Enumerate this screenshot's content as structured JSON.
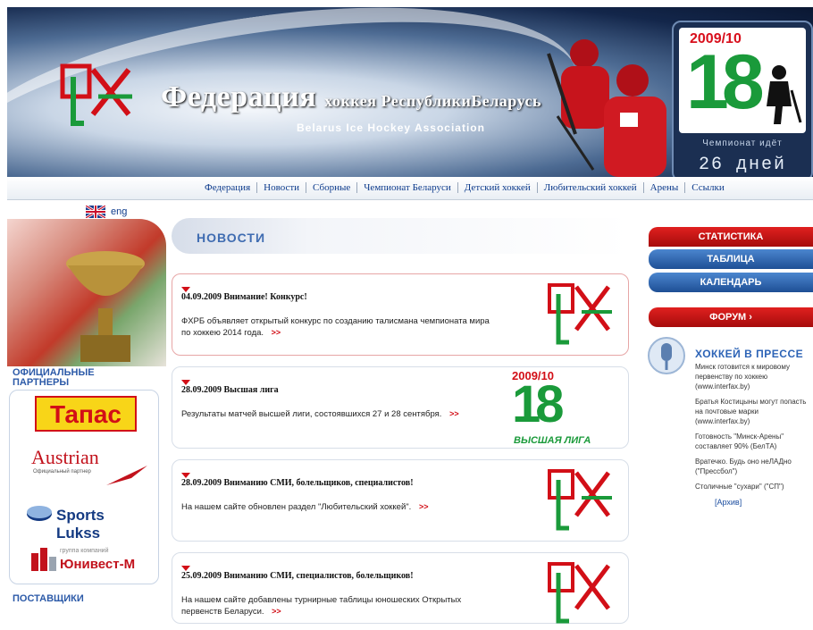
{
  "header": {
    "title_big": "Федерация",
    "title_small": "хоккея РеспубликиБеларусь",
    "subtitle": "Belarus Ice Hockey Association",
    "logo_text": "ФХ",
    "championship": {
      "season": "2009/10",
      "number": "18",
      "label": "Чемпионат идёт",
      "days": "26 дней"
    }
  },
  "nav": {
    "items": [
      "Федерация",
      "Новости",
      "Сборные",
      "Чемпионат Беларуси",
      "Детский хоккей",
      "Любительский хоккей",
      "Арены",
      "Ссылки"
    ]
  },
  "lang": {
    "label": "eng"
  },
  "partners": {
    "heading": "Официальные партнеры",
    "items": {
      "tapas": "Тапас",
      "austrian": "Austrian",
      "austrian_sub": "Официальный партнер",
      "sportslukss": "Sports Lukss",
      "univest_sub": "группа компаний",
      "univest": "Юнивест-М"
    }
  },
  "suppliers": {
    "heading": "Поставщики"
  },
  "news": {
    "title": "НОВОСТИ",
    "items": [
      {
        "headline": "04.09.2009 Внимание! Конкурс!",
        "body": "ФХРБ объявляет открытый конкурс по созданию талисмана чемпионата мира по хоккею 2014 года.",
        "more": ">>"
      },
      {
        "headline": "28.09.2009 Высшая лига",
        "body": "Результаты матчей высшей лиги, состоявшихся 27 и 28 сентября.",
        "more": ">>",
        "badge_season": "2009/10",
        "badge_number": "18",
        "badge_league": "ВЫСШАЯ ЛИГА"
      },
      {
        "headline": "28.09.2009 Вниманию СМИ, болельщиков, специалистов!",
        "body": "На нашем сайте обновлен раздел \"Любительский хоккей\".",
        "more": ">>"
      },
      {
        "headline": "25.09.2009 Вниманию СМИ, специалистов, болельщиков!",
        "body": "На нашем сайте добавлены турнирные таблицы юношеских Открытых первенств Беларуси.",
        "more": ">>"
      }
    ]
  },
  "sidebar": {
    "stats": "СТАТИСТИКА",
    "table": "ТАБЛИЦА",
    "calendar": "КАЛЕНДАРЬ",
    "forum": "ФОРУМ ›",
    "press_title": "ХОККЕЙ В ПРЕССЕ",
    "press_items": [
      "Минск готовится к мировому первенству по хоккею (www.interfax.by)",
      "Братья Костицыны могут попасть на почтовые марки (www.interfax.by)",
      "Готовность \"Минск-Арены\" составляет 90% (БелТА)",
      "Вратечко. Будь оно неЛАДно (\"Прессбол\")",
      "Столичные \"сухари\" (\"СП\")"
    ],
    "archive": "[Архив]"
  },
  "colors": {
    "brand_red": "#d20f17",
    "brand_green": "#1a9a3a",
    "link_blue": "#0d3b8c"
  }
}
